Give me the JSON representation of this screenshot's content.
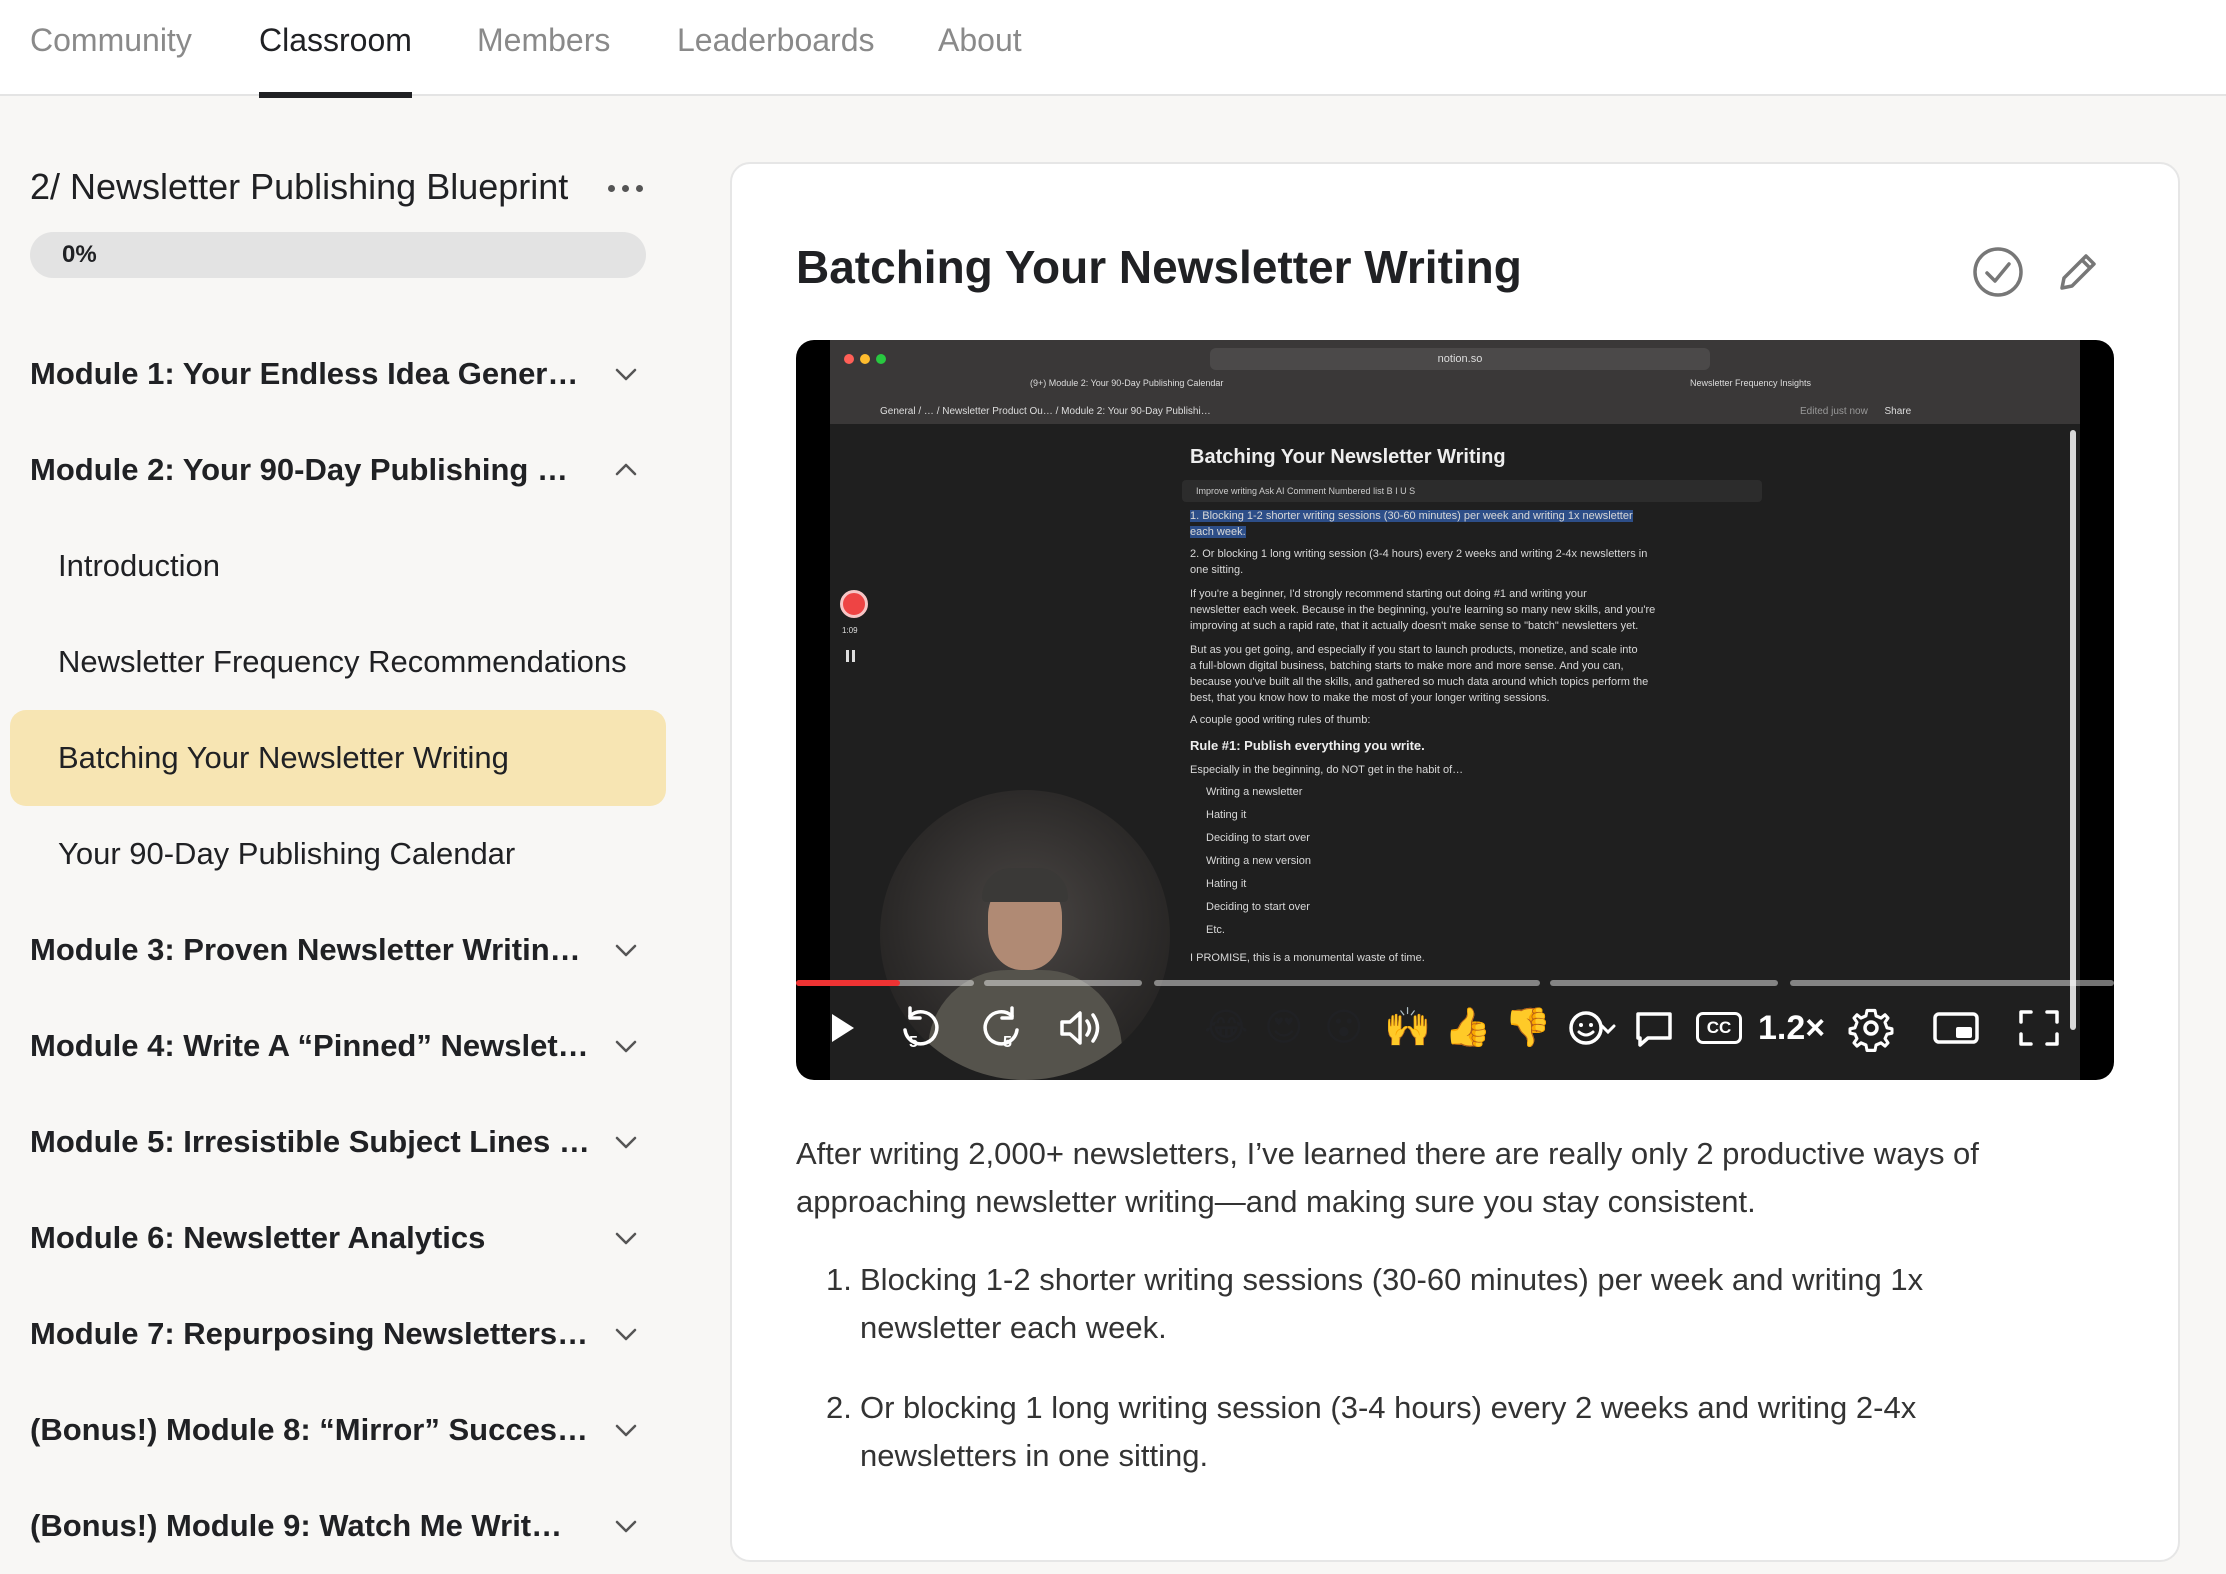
{
  "nav": {
    "tabs": [
      {
        "label": "Community"
      },
      {
        "label": "Classroom"
      },
      {
        "label": "Members"
      },
      {
        "label": "Leaderboards"
      },
      {
        "label": "About"
      }
    ],
    "active_tab": "Classroom"
  },
  "sidebar": {
    "course_title": "2/ Newsletter Publishing Blueprint",
    "progress_label": "0%",
    "progress": 0,
    "modules": [
      {
        "label": "Module 1: Your Endless Idea Gener…",
        "expanded": false
      },
      {
        "label": "Module 2: Your 90-Day Publishing …",
        "expanded": true
      },
      {
        "label": "Module 3: Proven Newsletter Writin…",
        "expanded": false
      },
      {
        "label": "Module 4: Write A “Pinned” Newslet…",
        "expanded": false
      },
      {
        "label": "Module 5: Irresistible Subject Lines …",
        "expanded": false
      },
      {
        "label": "Module 6: Newsletter Analytics",
        "expanded": false
      },
      {
        "label": "Module 7: Repurposing Newsletters…",
        "expanded": false
      },
      {
        "label": "(Bonus!) Module 8: “Mirror” Succes…",
        "expanded": false
      },
      {
        "label": "(Bonus!) Module 9: Watch Me Writ…",
        "expanded": false
      }
    ],
    "lessons": [
      {
        "label": "Introduction"
      },
      {
        "label": "Newsletter Frequency Recommendations"
      },
      {
        "label": "Batching Your Newsletter Writing"
      },
      {
        "label": "Your 90-Day Publishing Calendar"
      }
    ],
    "active_lesson": "Batching Your Newsletter Writing"
  },
  "lesson": {
    "title": "Batching Your Newsletter Writing",
    "complete_icon": "check-circle-icon",
    "edit_icon": "pencil-icon"
  },
  "video": {
    "browser": {
      "url": "notion.so",
      "tab1": "(9+) Module 2: Your 90-Day Publishing Calendar",
      "tab2": "Newsletter Frequency Insights",
      "breadcrumb": "General / … / Newsletter Product Ou… / Module 2: Your 90-Day Publishi…",
      "edited": "Edited just now",
      "share": "Share"
    },
    "doc": {
      "title": "Batching Your Newsletter Writing",
      "toolbar": "Improve writing   Ask AI   Comment   Numbered list   B  I  U  S",
      "lines": [
        "1.  Blocking 1-2 shorter writing sessions (30-60 minutes) per week and writing 1x newsletter",
        "      each week.",
        "2.  Or blocking 1 long writing session (3-4 hours) every 2 weeks and writing 2-4x newsletters in",
        "      one sitting.",
        "If you're a beginner, I'd strongly recommend starting out doing #1 and writing your",
        "newsletter each week. Because in the beginning, you're learning so many new skills, and you're",
        "improving at such a rapid rate, that it actually doesn't make sense to \"batch\" newsletters yet.",
        "But as you get going, and especially if you start to launch products, monetize, and scale into",
        "a full-blown digital business, batching starts to make more and more sense. And you can,",
        "because you've built all the skills, and gathered so much data around which topics perform the",
        "best, that you know how to make the most of your longer writing sessions.",
        "A couple good writing rules of thumb:"
      ],
      "rule_heading": "Rule #1: Publish everything you write.",
      "rule_sub": "Especially in the beginning, do NOT get in the habit of…",
      "bullets": [
        "Writing a newsletter",
        "Hating it",
        "Deciding to start over",
        "Writing a new version",
        "Hating it",
        "Deciding to start over",
        "Etc."
      ],
      "tail": "I PROMISE, this is a monumental waste of time.",
      "rec_time": "1:09"
    },
    "controls": {
      "play_icon": "play-icon",
      "rewind_label": "5",
      "forward_label": "5",
      "volume_icon": "volume-icon",
      "reactions": [
        "😂",
        "😍",
        "😮",
        "🙌",
        "👍",
        "👎"
      ],
      "add_reaction_icon": "add-reaction-icon",
      "comment_icon": "comment-icon",
      "captions_label": "CC",
      "speed_label": "1.2×",
      "settings_icon": "gear-icon",
      "pip_icon": "picture-in-picture-icon",
      "fullscreen_icon": "fullscreen-icon"
    }
  },
  "body": {
    "intro": "After writing 2,000+ newsletters, I’ve learned there are really only 2 productive ways of approaching newsletter writing—and making sure you stay consistent.",
    "list": [
      {
        "num": "1.",
        "text": "Blocking 1-2 shorter writing sessions (30-60 minutes) per week and writing 1x newsletter each week."
      },
      {
        "num": "2.",
        "text": "Or blocking 1 long writing session (3-4 hours) every 2 weeks and writing 2-4x newsletters in one sitting."
      }
    ]
  }
}
